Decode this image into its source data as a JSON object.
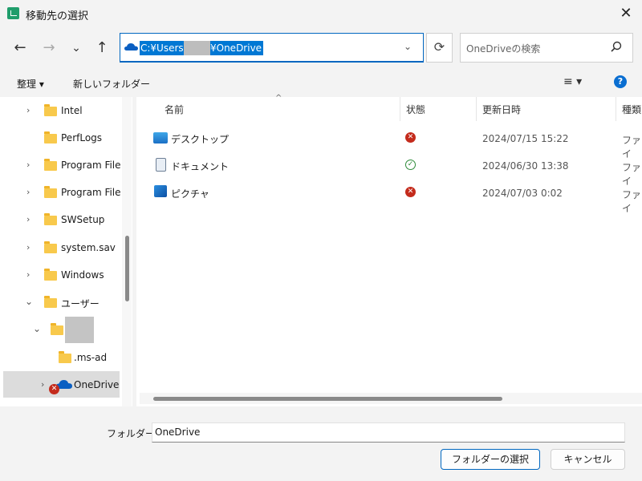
{
  "window": {
    "title": "移動先の選択",
    "close_glyph": "✕"
  },
  "nav": {
    "back_glyph": "←",
    "forward_glyph": "→",
    "recent_glyph": "⌄",
    "up_glyph": "↑",
    "address_prefix": "C:¥Users¥",
    "address_suffix": "¥OneDrive",
    "refresh_glyph": "⟳",
    "search_placeholder": "OneDriveの検索"
  },
  "command_bar": {
    "organize": "整理 ▾",
    "new_folder": "新しいフォルダー",
    "view_glyph": "≡ ▾",
    "help_glyph": "?"
  },
  "tree": [
    {
      "label": "Intel"
    },
    {
      "label": "PerfLogs"
    },
    {
      "label": "Program Files"
    },
    {
      "label": "Program Files"
    },
    {
      "label": "SWSetup"
    },
    {
      "label": "system.sav"
    },
    {
      "label": "Windows"
    },
    {
      "label": "ユーザー"
    },
    {
      "label": ""
    },
    {
      "label": ".ms-ad"
    },
    {
      "label": "OneDrive"
    }
  ],
  "columns": {
    "name": "名前",
    "status": "状態",
    "modified": "更新日時",
    "type": "種類"
  },
  "files": [
    {
      "name": "デスクトップ",
      "status": "error",
      "modified": "2024/07/15 15:22",
      "type": "ファイ"
    },
    {
      "name": "ドキュメント",
      "status": "ok",
      "modified": "2024/06/30 13:38",
      "type": "ファイ"
    },
    {
      "name": "ピクチャ",
      "status": "error",
      "modified": "2024/07/03 0:02",
      "type": "ファイ"
    }
  ],
  "footer": {
    "folder_label": "フォルダー:",
    "folder_value": "OneDrive",
    "select_button": "フォルダーの選択",
    "cancel_button": "キャンセル"
  },
  "colors": {
    "accent": "#0078d4",
    "error": "#c42b1c",
    "ok": "#2e8b3a",
    "folder": "#f8c94c"
  }
}
